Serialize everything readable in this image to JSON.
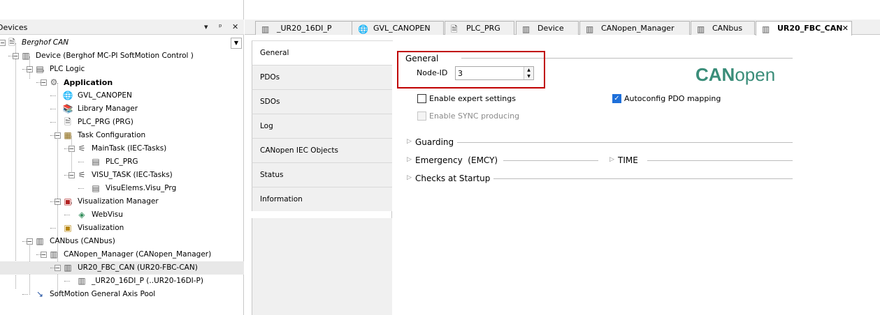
{
  "devices_panel": {
    "title": "Devices",
    "dock_buttons": [
      "▾",
      "ᵖ",
      "✕"
    ],
    "tree": [
      {
        "label": "Berghof CAN",
        "icon": "project-icon",
        "italic": true
      },
      {
        "label": "Device (Berghof MC-PI SoftMotion Control )",
        "icon": "device-icon"
      },
      {
        "label": "PLC Logic",
        "icon": "plc-logic-icon"
      },
      {
        "label": "Application",
        "icon": "application-gear-icon",
        "bold": true
      },
      {
        "label": "GVL_CANOPEN",
        "icon": "globe-icon"
      },
      {
        "label": "Library Manager",
        "icon": "library-icon"
      },
      {
        "label": "PLC_PRG (PRG)",
        "icon": "program-icon"
      },
      {
        "label": "Task Configuration",
        "icon": "task-config-icon"
      },
      {
        "label": "MainTask (IEC-Tasks)",
        "icon": "task-icon"
      },
      {
        "label": "PLC_PRG",
        "icon": "pou-call-icon"
      },
      {
        "label": "VISU_TASK (IEC-Tasks)",
        "icon": "task-icon"
      },
      {
        "label": "VisuElems.Visu_Prg",
        "icon": "pou-call-icon"
      },
      {
        "label": "Visualization Manager",
        "icon": "visu-manager-icon"
      },
      {
        "label": "WebVisu",
        "icon": "webvisu-icon"
      },
      {
        "label": "Visualization",
        "icon": "visualization-icon"
      },
      {
        "label": "CANbus (CANbus)",
        "icon": "canbus-icon"
      },
      {
        "label": "CANopen_Manager (CANopen_Manager)",
        "icon": "canopen-manager-icon"
      },
      {
        "label": "UR20_FBC_CAN (UR20-FBC-CAN)",
        "icon": "module-icon",
        "selected": true
      },
      {
        "label": "_UR20_16DI_P (..UR20-16DI-P)",
        "icon": "module-icon"
      },
      {
        "label": "SoftMotion General Axis Pool",
        "icon": "axis-pool-icon"
      }
    ]
  },
  "editor_tabs": [
    {
      "label": "_UR20_16DI_P",
      "icon": "module-icon"
    },
    {
      "label": "GVL_CANOPEN",
      "icon": "globe-icon"
    },
    {
      "label": "PLC_PRG",
      "icon": "program-icon"
    },
    {
      "label": "Device",
      "icon": "device-icon"
    },
    {
      "label": "CANopen_Manager",
      "icon": "canopen-manager-icon"
    },
    {
      "label": "CANbus",
      "icon": "canbus-icon"
    },
    {
      "label": "UR20_FBC_CAN",
      "icon": "module-icon",
      "active": true,
      "close": "✕"
    }
  ],
  "side_tabs": [
    "General",
    "PDOs",
    "SDOs",
    "Log",
    "CANopen IEC Objects",
    "Status",
    "Information"
  ],
  "general": {
    "section_title": "General",
    "node_id_label": "Node-ID",
    "node_id_value": "3",
    "enable_expert_settings": {
      "label": "Enable expert settings",
      "checked": false
    },
    "enable_sync_producing": {
      "label": "Enable SYNC producing",
      "checked": false,
      "disabled": true
    },
    "autoconfig_pdo": {
      "label": "Autoconfig PDO mapping",
      "checked": true
    },
    "logo": {
      "part1": "CAN",
      "part2": "open"
    }
  },
  "collapsible_sections": {
    "guarding": "Guarding",
    "emergency": "Emergency  (EMCY)",
    "time": "TIME",
    "checks": "Checks at Startup"
  },
  "colors": {
    "highlight_box": "#c00000",
    "canopen_logo": "#3a8d79",
    "checkbox_checked": "#1e6fd9"
  }
}
